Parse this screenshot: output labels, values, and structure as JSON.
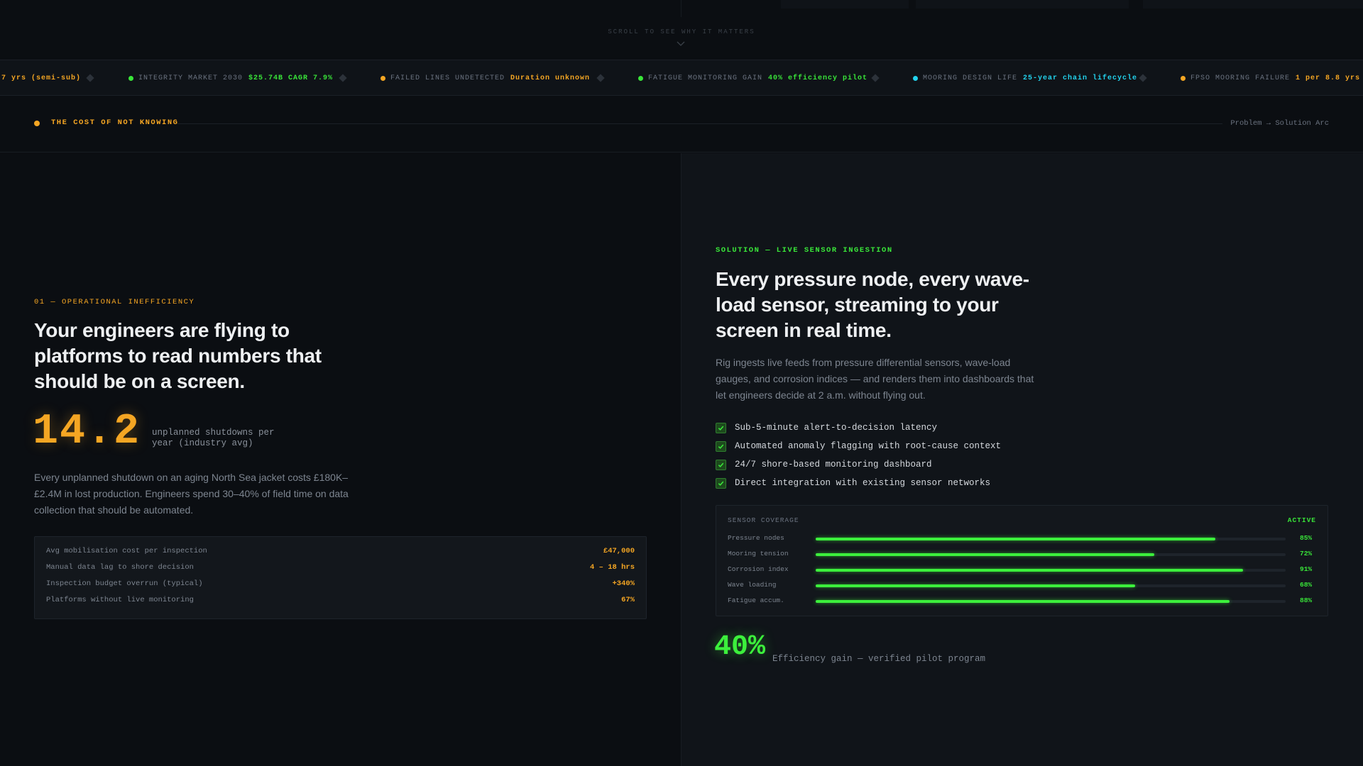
{
  "hero": {
    "scroll_hint": "SCROLL TO SEE WHY IT MATTERS"
  },
  "ticker": [
    {
      "label": "",
      "value": "7 yrs (semi-sub)",
      "dot_color": "",
      "value_color": "#f5a623"
    },
    {
      "label": "INTEGRITY MARKET 2030",
      "value": "$25.74B CAGR 7.9%",
      "dot_color": "#39e639",
      "value_color": "#39e639"
    },
    {
      "label": "FAILED LINES UNDETECTED",
      "value": "Duration unknown",
      "dot_color": "#f5a623",
      "value_color": "#f5a623"
    },
    {
      "label": "FATIGUE MONITORING GAIN",
      "value": "40% efficiency pilot",
      "dot_color": "#39e639",
      "value_color": "#39e639"
    },
    {
      "label": "MOORING DESIGN LIFE",
      "value": "25-year chain lifecycle",
      "dot_color": "#22d3ee",
      "value_color": "#22d3ee"
    },
    {
      "label": "FPSO MOORING FAILURE",
      "value": "1 per 8.8 yrs av",
      "dot_color": "#f5a623",
      "value_color": "#f5a623"
    }
  ],
  "section": {
    "title": "THE COST OF NOT KNOWING",
    "right_label": "Problem → Solution Arc"
  },
  "problem": {
    "eyebrow": "01 — OPERATIONAL INEFFICIENCY",
    "headline": "Your engineers are flying to platforms to read numbers that should be on a screen.",
    "stat_value": "14.2",
    "stat_label": "unplanned shutdowns per year (industry avg)",
    "body": "Every unplanned shutdown on an aging North Sea jacket costs £180K–£2.4M in lost production. Engineers spend 30–40% of field time on data collection that should be automated.",
    "table": [
      {
        "key": "Avg mobilisation cost per inspection",
        "value": "£47,000"
      },
      {
        "key": "Manual data lag to shore decision",
        "value": "4 – 18 hrs"
      },
      {
        "key": "Inspection budget overrun (typical)",
        "value": "+340%"
      },
      {
        "key": "Platforms without live monitoring",
        "value": "67%"
      }
    ]
  },
  "solution": {
    "eyebrow": "SOLUTION — LIVE SENSOR INGESTION",
    "headline": "Every pressure node, every wave-load sensor, streaming to your screen in real time.",
    "body": "Rig ingests live feeds from pressure differential sensors, wave-load gauges, and corrosion indices — and renders them into dashboards that let engineers decide at 2 a.m. without flying out.",
    "checks": [
      "Sub-5-minute alert-to-decision latency",
      "Automated anomaly flagging with root-cause context",
      "24/7 shore-based monitoring dashboard",
      "Direct integration with existing sensor networks"
    ],
    "coverage": {
      "title": "SENSOR COVERAGE",
      "status": "ACTIVE",
      "rows": [
        {
          "label": "Pressure nodes",
          "pct_label": "85%",
          "value": 0.85
        },
        {
          "label": "Mooring tension",
          "pct_label": "72%",
          "value": 0.72
        },
        {
          "label": "Corrosion index",
          "pct_label": "91%",
          "value": 0.91
        },
        {
          "label": "Wave loading",
          "pct_label": "68%",
          "value": 0.68
        },
        {
          "label": "Fatigue accum.",
          "pct_label": "88%",
          "value": 0.88
        }
      ]
    },
    "gain_value": "40%",
    "gain_label": "Efficiency gain — verified pilot program"
  },
  "colors": {
    "accent_amber": "#f5a623",
    "accent_green": "#39e639",
    "accent_cyan": "#22d3ee"
  }
}
